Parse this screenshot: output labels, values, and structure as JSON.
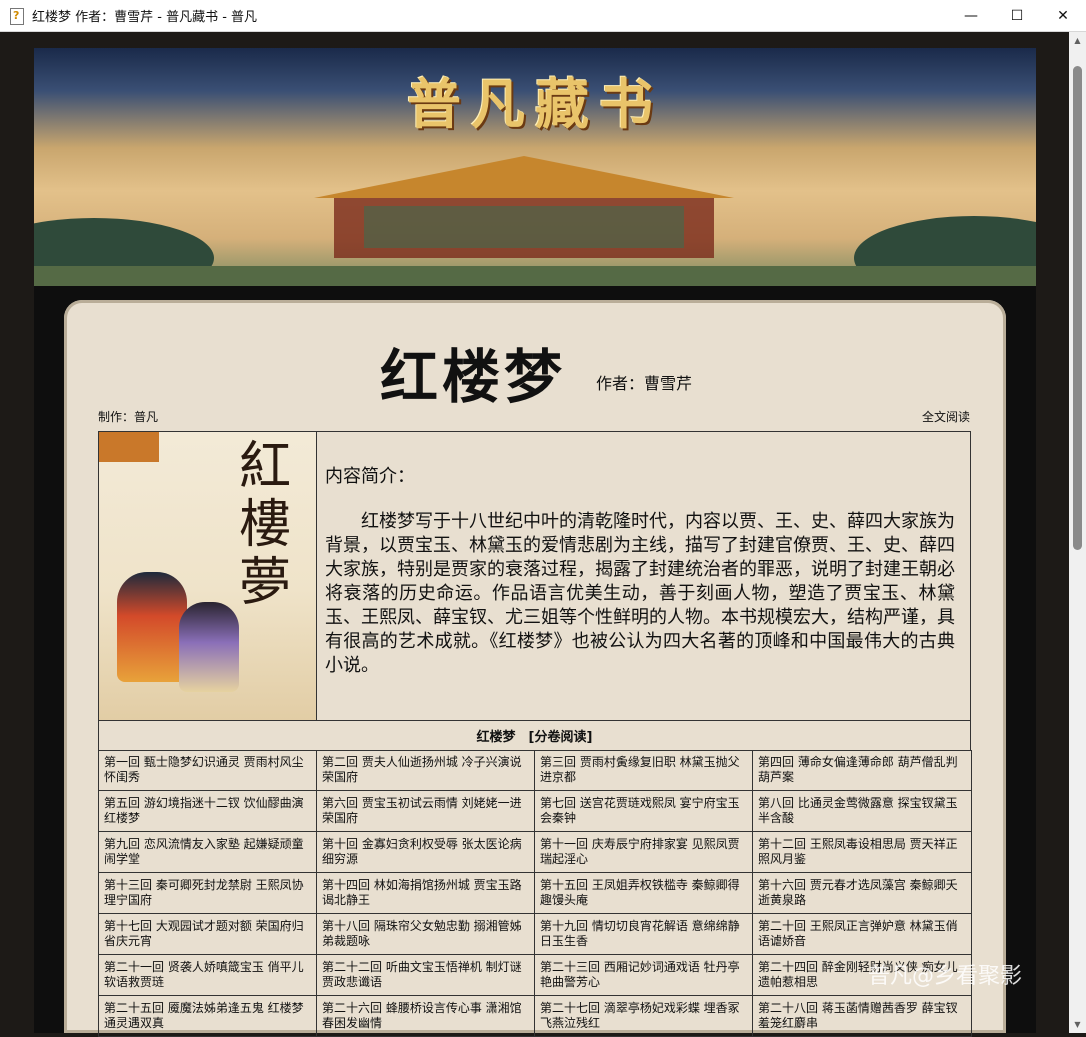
{
  "window": {
    "title": "红楼梦 作者：曹雪芹 - 普凡藏书 - 普凡",
    "controls": [
      "—",
      "☐",
      "✕"
    ]
  },
  "banner": {
    "title": "普凡藏书"
  },
  "book": {
    "title": "红楼梦",
    "author": "作者：曹雪芹",
    "maker": "制作：普凡",
    "fulltext_link": "全文阅读"
  },
  "intro": {
    "heading": "内容简介：",
    "text": "红楼梦写于十八世纪中叶的清乾隆时代，内容以贾、王、史、薛四大家族为背景，以贾宝玉、林黛玉的爱情悲剧为主线，描写了封建官僚贾、王、史、薛四大家族，特别是贾家的衰落过程，揭露了封建统治者的罪恶，说明了封建王朝必将衰落的历史命运。作品语言优美生动，善于刻画人物，塑造了贾宝玉、林黛玉、王熙凤、薛宝钗、尤三姐等个性鲜明的人物。本书规模宏大，结构严谨，具有很高的艺术成就。《红楼梦》也被公认为四大名著的顶峰和中国最伟大的古典小说。"
  },
  "cover": {
    "title": "紅樓夢"
  },
  "chapters_header": "红楼梦　[分卷阅读]",
  "chapters": [
    "第一回 甄士隐梦幻识通灵 贾雨村风尘怀闺秀",
    "第二回 贾夫人仙逝扬州城 冷子兴演说荣国府",
    "第三回 贾雨村夤缘复旧职 林黛玉抛父进京都",
    "第四回 薄命女偏逢薄命郎 葫芦僧乱判葫芦案",
    "第五回 游幻境指迷十二钗 饮仙醪曲演红楼梦",
    "第六回 贾宝玉初试云雨情 刘姥姥一进荣国府",
    "第七回 送宫花贾琏戏熙凤 宴宁府宝玉会秦钟",
    "第八回 比通灵金莺微露意 探宝钗黛玉半含酸",
    "第九回 恋风流情友入家塾 起嫌疑顽童闹学堂",
    "第十回 金寡妇贪利权受辱 张太医论病细穷源",
    "第十一回 庆寿辰宁府排家宴 见熙凤贾瑞起淫心",
    "第十二回 王熙凤毒设相思局 贾天祥正照风月鉴",
    "第十三回 秦可卿死封龙禁尉 王熙凤协理宁国府",
    "第十四回 林如海捐馆扬州城 贾宝玉路谒北静王",
    "第十五回 王凤姐弄权铁槛寺 秦鲸卿得趣馒头庵",
    "第十六回 贾元春才选凤藻宫 秦鲸卿夭逝黄泉路",
    "第十七回 大观园试才题对额 荣国府归省庆元宵",
    "第十八回 隔珠帘父女勉忠勤 搦湘管姊弟裁题咏",
    "第十九回 情切切良宵花解语 意绵绵静日玉生香",
    "第二十回 王熙凤正言弹妒意 林黛玉俏语谑娇音",
    "第二十一回 贤袭人娇嗔箴宝玉 俏平儿软语救贾琏",
    "第二十二回 听曲文宝玉悟禅机 制灯谜贾政悲谶语",
    "第二十三回 西厢记妙词通戏语 牡丹亭艳曲警芳心",
    "第二十四回 醉金刚轻财尚义侠 痴女儿遗帕惹相思",
    "第二十五回 魇魔法姊弟逢五鬼 红楼梦通灵遇双真",
    "第二十六回 蜂腰桥设言传心事 潇湘馆春困发幽情",
    "第二十七回 滴翠亭杨妃戏彩蝶 埋香冢飞燕泣残红",
    "第二十八回 蒋玉菡情赠茜香罗 薛宝钗羞笼红麝串"
  ],
  "watermark": "普凡@乡看聚影"
}
